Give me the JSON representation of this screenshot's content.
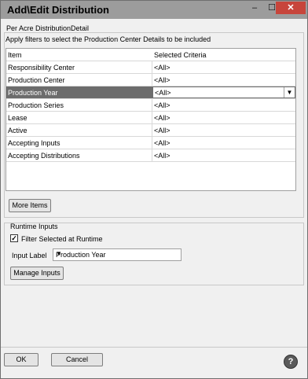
{
  "window": {
    "title": "Add\\Edit Distribution",
    "controls": {
      "minimize": "–",
      "maximize": "☐",
      "close": "✕"
    }
  },
  "section_title": "Per Acre DistributionDetail",
  "filter_group": {
    "caption": "Apply filters to select the Production Center Details to be included",
    "columns": {
      "item": "Item",
      "criteria": "Selected Criteria"
    },
    "rows": [
      {
        "item": "Responsibility Center",
        "criteria": "<All>"
      },
      {
        "item": "Production Center",
        "criteria": "<All>"
      },
      {
        "item": "Production Year",
        "criteria": "<All>",
        "selected": true
      },
      {
        "item": "Production Series",
        "criteria": "<All>"
      },
      {
        "item": "Lease",
        "criteria": "<All>"
      },
      {
        "item": "Active",
        "criteria": "<All>"
      },
      {
        "item": "Accepting Inputs",
        "criteria": "<All>"
      },
      {
        "item": "Accepting Distributions",
        "criteria": "<All>"
      }
    ],
    "more_items_label": "More Items"
  },
  "runtime_inputs": {
    "caption": "Runtime Inputs",
    "filter_checkbox_label": "Filter Selected at Runtime",
    "filter_checked": true,
    "input_label": "Input Label",
    "input_value": "Production Year",
    "manage_label": "Manage Inputs"
  },
  "footer": {
    "ok_label": "OK",
    "cancel_label": "Cancel",
    "help_label": "?"
  },
  "colors": {
    "selection": "#6c6c6c",
    "close_button": "#c7453b",
    "titlebar": "#9c9c9c"
  }
}
